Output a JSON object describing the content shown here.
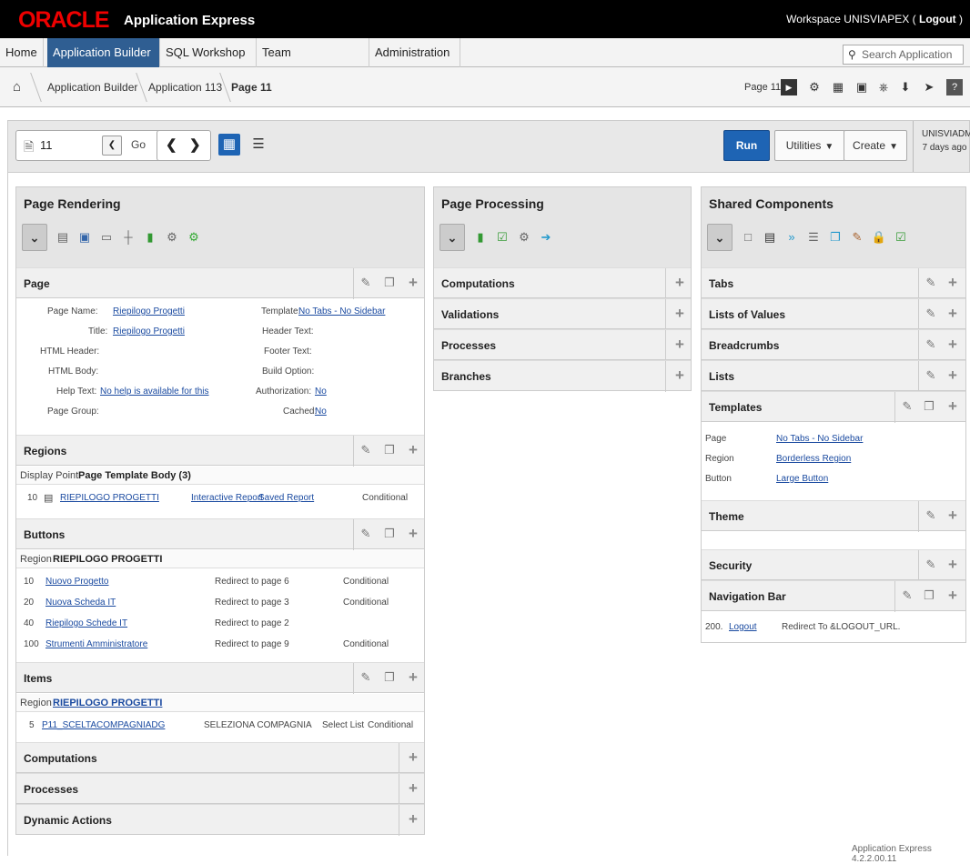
{
  "header": {
    "logo": "ORACLE",
    "product": "Application Express",
    "workspace": "Workspace UNISVIAPEX",
    "logout": "Logout"
  },
  "nav": {
    "home": "Home",
    "app_builder": "Application Builder",
    "sql_workshop": "SQL Workshop",
    "team_dev": "Team Development",
    "admin": "Administration",
    "search_placeholder": "Search Application"
  },
  "breadcrumb": {
    "b1": "Application Builder",
    "b2": "Application 113",
    "b3": "Page 11",
    "page_label": "Page 11"
  },
  "toolbar": {
    "page_num": "11",
    "go": "Go",
    "run": "Run",
    "utilities": "Utilities",
    "create": "Create",
    "user": "UNISVIADM",
    "ago": "7 days ago"
  },
  "rendering": {
    "title": "Page Rendering",
    "page_label": "Page",
    "page_props": {
      "page_name_k": "Page Name:",
      "page_name_v": "Riepilogo Progetti",
      "title_k": "Title:",
      "title_v": "Riepilogo Progetti",
      "html_header_k": "HTML Header:",
      "html_body_k": "HTML Body:",
      "help_k": "Help Text:",
      "help_v": "No help is available for this",
      "group_k": "Page Group:",
      "template_k": "Template:",
      "template_v": "No Tabs - No Sidebar",
      "header_text_k": "Header Text:",
      "footer_text_k": "Footer Text:",
      "build_k": "Build Option:",
      "auth_k": "Authorization:",
      "auth_v": "No",
      "cached_k": "Cached:",
      "cached_v": "No"
    },
    "regions_label": "Regions",
    "display_point_k": "Display Point",
    "display_point_v": "Page Template Body (3)",
    "region_row": {
      "seq": "10",
      "name": "RIEPILOGO PROGETTI",
      "type1": "Interactive Report",
      "type2": "Saved Report",
      "cond": "Conditional"
    },
    "buttons_label": "Buttons",
    "buttons_region_k": "Region",
    "buttons_region_v": "RIEPILOGO PROGETTI",
    "buttons": [
      {
        "seq": "10",
        "name": "Nuovo Progetto",
        "action": "Redirect to page 6",
        "cond": "Conditional"
      },
      {
        "seq": "20",
        "name": "Nuova Scheda IT",
        "action": "Redirect to page 3",
        "cond": "Conditional"
      },
      {
        "seq": "40",
        "name": "Riepilogo Schede IT",
        "action": "Redirect to page 2",
        "cond": ""
      },
      {
        "seq": "100",
        "name": "Strumenti Amministratore",
        "action": "Redirect to page 9",
        "cond": "Conditional"
      }
    ],
    "items_label": "Items",
    "items_region_k": "Region",
    "items_region_v": "RIEPILOGO PROGETTI",
    "item_row": {
      "seq": "5",
      "name": "P11_SCELTACOMPAGNIADG",
      "label": "SELEZIONA COMPAGNIA",
      "type": "Select List",
      "cond": "Conditional"
    },
    "computations_label": "Computations",
    "processes_label": "Processes",
    "dynamic_label": "Dynamic Actions"
  },
  "processing": {
    "title": "Page Processing",
    "computations": "Computations",
    "validations": "Validations",
    "processes": "Processes",
    "branches": "Branches"
  },
  "shared": {
    "title": "Shared Components",
    "tabs": "Tabs",
    "lov": "Lists of Values",
    "breadcrumbs": "Breadcrumbs",
    "lists": "Lists",
    "templates": "Templates",
    "tpl_page_k": "Page",
    "tpl_page_v": "No Tabs - No Sidebar",
    "tpl_region_k": "Region",
    "tpl_region_v": "Borderless Region",
    "tpl_button_k": "Button",
    "tpl_button_v": "Large Button",
    "theme": "Theme",
    "security": "Security",
    "navbar": "Navigation Bar",
    "nav_seq": "200.",
    "nav_name": "Logout",
    "nav_target": "Redirect To &LOGOUT_URL."
  },
  "footer": "Application Express 4.2.2.00.11"
}
